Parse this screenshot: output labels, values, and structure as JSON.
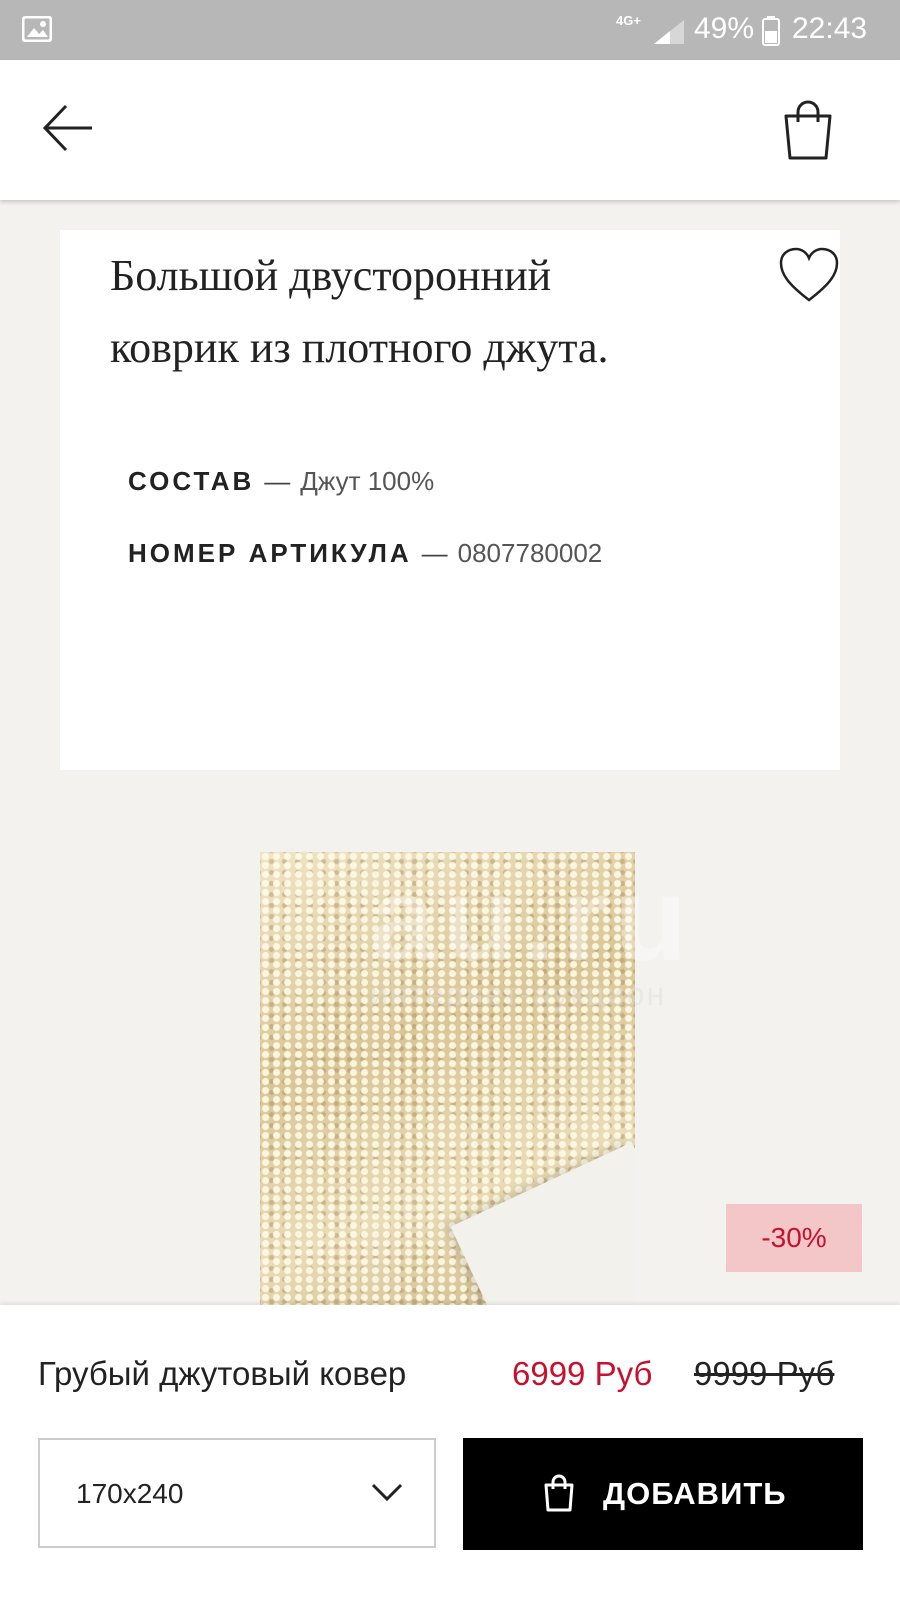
{
  "status_bar": {
    "network": "4G+",
    "battery_percent": "49%",
    "time": "22:43",
    "icons": [
      "gallery-icon",
      "signal-icon",
      "battery-icon"
    ]
  },
  "header": {
    "icons": [
      "back-arrow-icon",
      "shopping-bag-icon"
    ]
  },
  "product_card": {
    "description_line1": "Большой двусторонний",
    "description_line2": "коврик из плотного джута.",
    "specs": [
      {
        "label": "СОСТАВ",
        "separator": "—",
        "value": "Джут 100%"
      },
      {
        "label": "НОМЕР АРТИКУЛА",
        "separator": "—",
        "value": "0807780002"
      }
    ],
    "favorite_icon": "heart-icon"
  },
  "image": {
    "watermark_main": "au.ru",
    "watermark_sub": "интернет-аукцион",
    "discount_badge": "-30%"
  },
  "bottom_bar": {
    "product_name": "Грубый джутовый ковер",
    "price": "6999 Руб",
    "old_price": "9999 Руб",
    "size_value": "170x240",
    "add_button_label": "ДОБАВИТЬ"
  },
  "colors": {
    "sale_red": "#c8102e",
    "badge_bg": "#f3c6c8",
    "button_bg": "#000000"
  }
}
